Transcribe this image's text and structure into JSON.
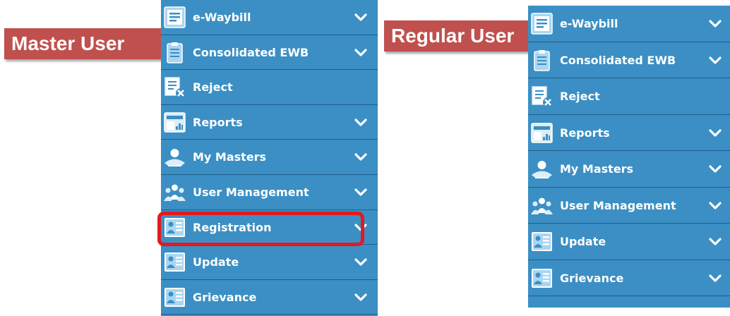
{
  "master": {
    "label": "Master User",
    "highlighted_item": "Registration",
    "items": [
      {
        "label": "e-Waybill",
        "icon": "document-list-icon",
        "chevron": true
      },
      {
        "label": "Consolidated EWB",
        "icon": "clipboard-icon",
        "chevron": true
      },
      {
        "label": "Reject",
        "icon": "document-reject-icon",
        "chevron": false
      },
      {
        "label": "Reports",
        "icon": "report-chart-icon",
        "chevron": true
      },
      {
        "label": "My Masters",
        "icon": "masters-user-icon",
        "chevron": true
      },
      {
        "label": "User Management",
        "icon": "user-group-icon",
        "chevron": true
      },
      {
        "label": "Registration",
        "icon": "id-card-icon",
        "chevron": true
      },
      {
        "label": "Update",
        "icon": "id-card-icon",
        "chevron": true
      },
      {
        "label": "Grievance",
        "icon": "id-card-icon",
        "chevron": true
      }
    ]
  },
  "regular": {
    "label": "Regular User",
    "items": [
      {
        "label": "e-Waybill",
        "icon": "document-list-icon",
        "chevron": true
      },
      {
        "label": "Consolidated EWB",
        "icon": "clipboard-icon",
        "chevron": true
      },
      {
        "label": "Reject",
        "icon": "document-reject-icon",
        "chevron": false
      },
      {
        "label": "Reports",
        "icon": "report-chart-icon",
        "chevron": true
      },
      {
        "label": "My Masters",
        "icon": "masters-user-icon",
        "chevron": true
      },
      {
        "label": "User Management",
        "icon": "user-group-icon",
        "chevron": true
      },
      {
        "label": "Update",
        "icon": "id-card-icon",
        "chevron": true
      },
      {
        "label": "Grievance",
        "icon": "id-card-icon",
        "chevron": true
      }
    ]
  },
  "colors": {
    "menu_bg": "#3b8fc4",
    "divider": "#1f5e8a",
    "tag_bg": "#c0504d",
    "highlight": "#e3191f"
  }
}
